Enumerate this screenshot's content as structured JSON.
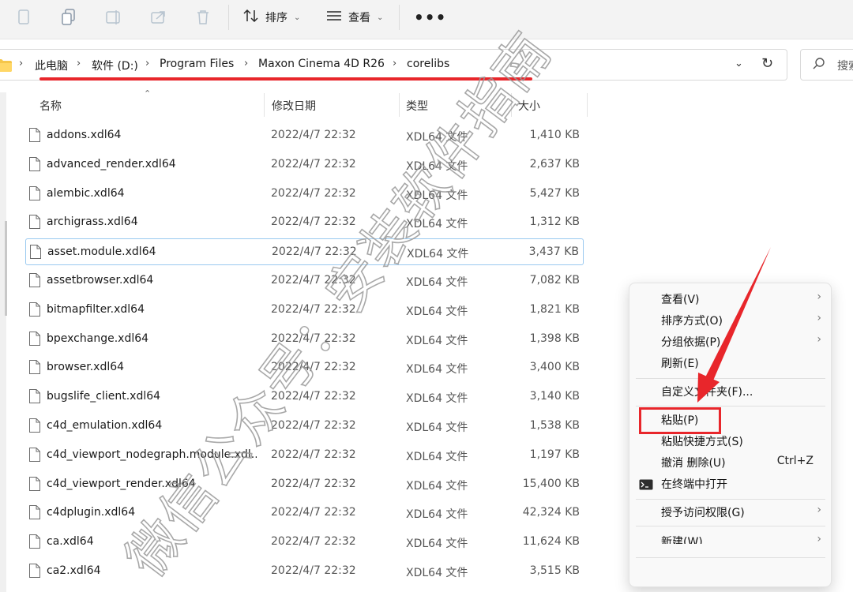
{
  "toolbar": {
    "sort_label": "排序",
    "view_label": "查看",
    "more_label": "•••"
  },
  "address": {
    "crumbs": [
      "此电脑",
      "软件 (D:)",
      "Program Files",
      "Maxon Cinema 4D R26",
      "corelibs"
    ]
  },
  "search": {
    "placeholder": "搜索"
  },
  "columns": {
    "name": "名称",
    "date": "修改日期",
    "type": "类型",
    "size": "大小"
  },
  "files": [
    {
      "name": "addons.xdl64",
      "date": "2022/4/7 22:32",
      "type": "XDL64 文件",
      "size": "1,410 KB"
    },
    {
      "name": "advanced_render.xdl64",
      "date": "2022/4/7 22:32",
      "type": "XDL64 文件",
      "size": "2,637 KB"
    },
    {
      "name": "alembic.xdl64",
      "date": "2022/4/7 22:32",
      "type": "XDL64 文件",
      "size": "5,427 KB"
    },
    {
      "name": "archigrass.xdl64",
      "date": "2022/4/7 22:32",
      "type": "XDL64 文件",
      "size": "1,312 KB"
    },
    {
      "name": "asset.module.xdl64",
      "date": "2022/4/7 22:32",
      "type": "XDL64 文件",
      "size": "3,437 KB"
    },
    {
      "name": "assetbrowser.xdl64",
      "date": "2022/4/7 22:32",
      "type": "XDL64 文件",
      "size": "7,082 KB"
    },
    {
      "name": "bitmapfilter.xdl64",
      "date": "2022/4/7 22:32",
      "type": "XDL64 文件",
      "size": "1,821 KB"
    },
    {
      "name": "bpexchange.xdl64",
      "date": "2022/4/7 22:32",
      "type": "XDL64 文件",
      "size": "1,398 KB"
    },
    {
      "name": "browser.xdl64",
      "date": "2022/4/7 22:32",
      "type": "XDL64 文件",
      "size": "3,400 KB"
    },
    {
      "name": "bugslife_client.xdl64",
      "date": "2022/4/7 22:32",
      "type": "XDL64 文件",
      "size": "3,140 KB"
    },
    {
      "name": "c4d_emulation.xdl64",
      "date": "2022/4/7 22:32",
      "type": "XDL64 文件",
      "size": "1,538 KB"
    },
    {
      "name": "c4d_viewport_nodegraph.module.xdl...",
      "date": "2022/4/7 22:32",
      "type": "XDL64 文件",
      "size": "1,197 KB"
    },
    {
      "name": "c4d_viewport_render.xdl64",
      "date": "2022/4/7 22:32",
      "type": "XDL64 文件",
      "size": "15,400 KB"
    },
    {
      "name": "c4dplugin.xdl64",
      "date": "2022/4/7 22:32",
      "type": "XDL64 文件",
      "size": "42,324 KB"
    },
    {
      "name": "ca.xdl64",
      "date": "2022/4/7 22:32",
      "type": "XDL64 文件",
      "size": "11,624 KB"
    },
    {
      "name": "ca2.xdl64",
      "date": "2022/4/7 22:32",
      "type": "XDL64 文件",
      "size": "3,515 KB"
    }
  ],
  "selected_file": "asset.module.xdl64",
  "context_menu": {
    "view": "查看(V)",
    "sort": "排序方式(O)",
    "group": "分组依据(P)",
    "refresh": "刷新(E)",
    "customize": "自定义文件夹(F)...",
    "paste": "粘贴(P)",
    "paste_shortcut": "粘贴快捷方式(S)",
    "undo_delete": "撤消 删除(U)",
    "undo_shortcut": "Ctrl+Z",
    "terminal": "在终端中打开",
    "give_access": "授予访问权限(G)",
    "new": "新建(W)"
  },
  "watermark": {
    "text": "微信公众号：安装软件指南"
  },
  "colors": {
    "annotation_red": "#e8262b",
    "accent_blue": "#0067c0"
  }
}
